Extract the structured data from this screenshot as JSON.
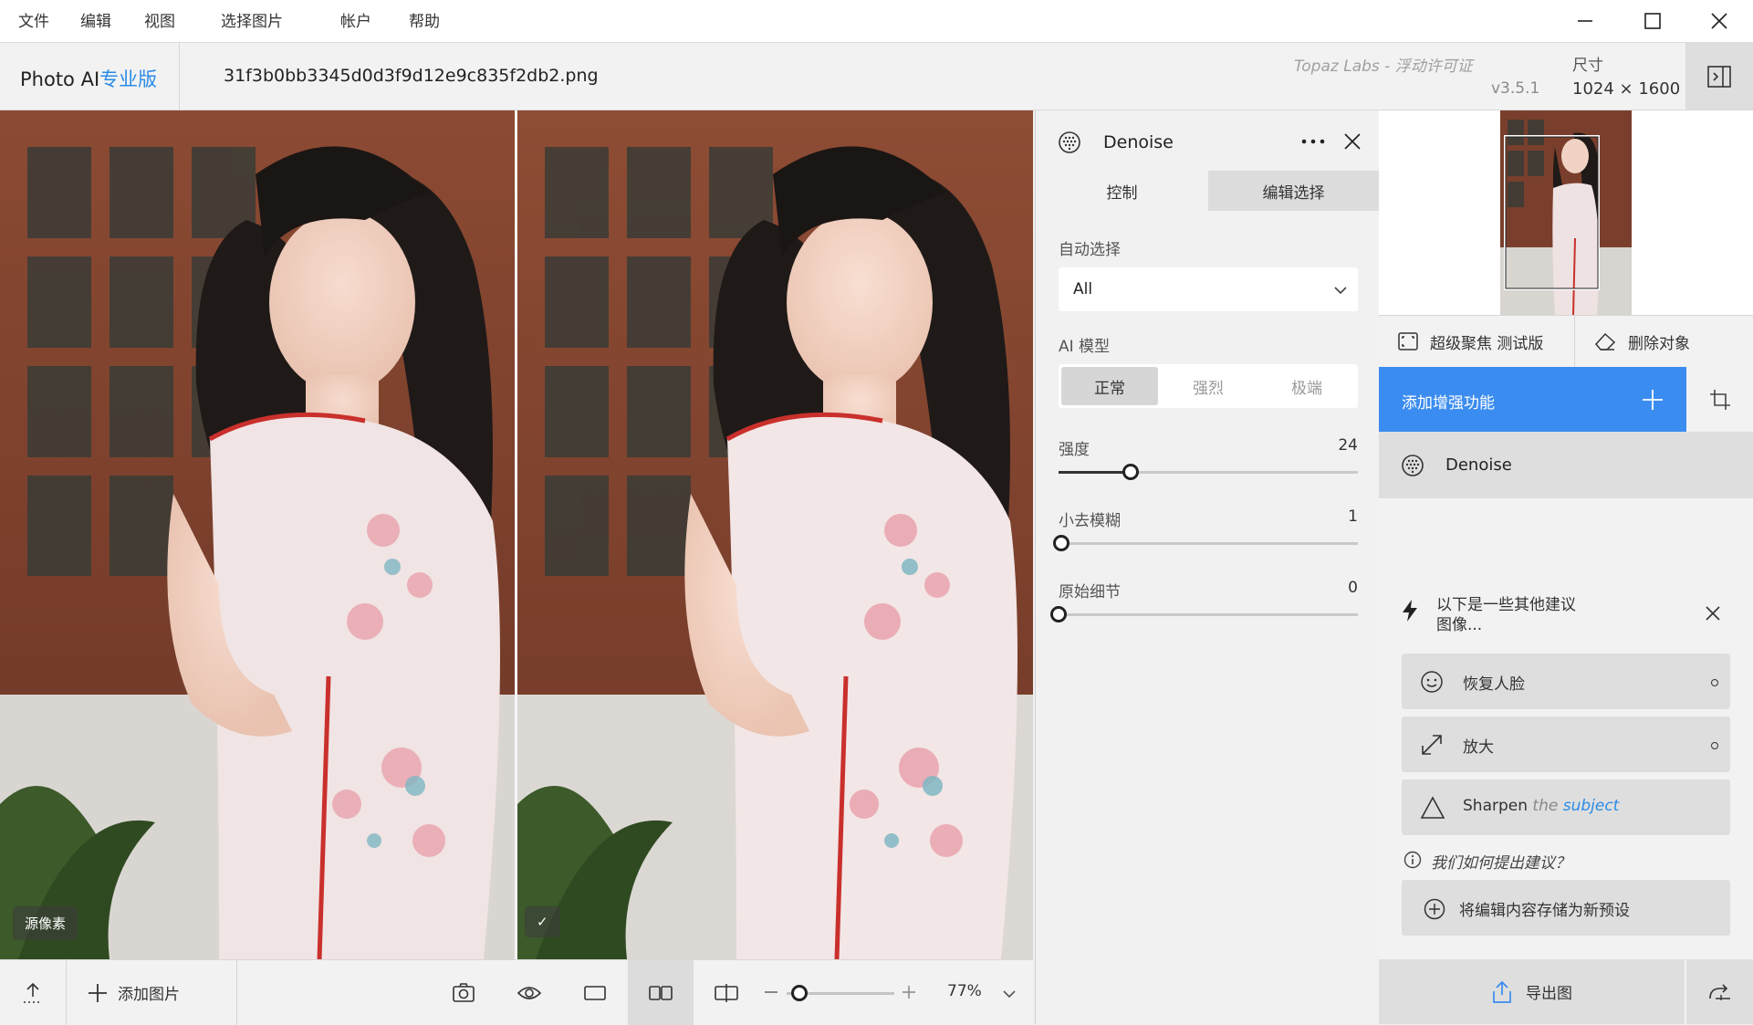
{
  "menu": [
    "文件",
    "编辑",
    "视图",
    "选择图片",
    "帐户",
    "帮助"
  ],
  "header": {
    "brand": "Photo AI",
    "brand_pro": "专业版",
    "filename": "31f3b0bb3345d0d3f9d12e9c835f2db2.png",
    "license": "Topaz Labs - 浮动许可证",
    "version": "v3.5.1",
    "size_label": "尺寸",
    "size_value": "1024 × 1600"
  },
  "preview": {
    "left_badge": "源像素",
    "right_badge": "✓"
  },
  "bottombar": {
    "add_image": "添加图片",
    "zoom": "77%",
    "zoom_level": 0.12
  },
  "panel": {
    "title": "Denoise",
    "tabs": [
      "控制",
      "编辑选择"
    ],
    "auto_select_label": "自动选择",
    "auto_select_value": "All",
    "model_label": "AI 模型",
    "models": [
      "正常",
      "强烈",
      "极端"
    ],
    "selected_model": "正常",
    "sliders": [
      {
        "label": "强度",
        "value": 24
      },
      {
        "label": "小去模糊",
        "value": 1
      },
      {
        "label": "原始细节",
        "value": 0
      }
    ]
  },
  "sidebar": {
    "tools": [
      "超级聚焦 测试版",
      "删除对象"
    ],
    "add_enhancement": "添加增强功能",
    "active_filter": "Denoise",
    "suggestion_title": "以下是一些其他建议",
    "suggestion_title2": "图像...",
    "suggestions": [
      "恢复人脸",
      "放大"
    ],
    "sharpen": {
      "word": "Sharpen",
      "the": "the",
      "subject": "subject"
    },
    "how_link": "我们如何提出建议？",
    "save_preset": "将编辑内容存储为新预设",
    "export": "导出图"
  },
  "colors": {
    "accent": "#2b8be6",
    "primary_button": "#3b8cf0"
  }
}
